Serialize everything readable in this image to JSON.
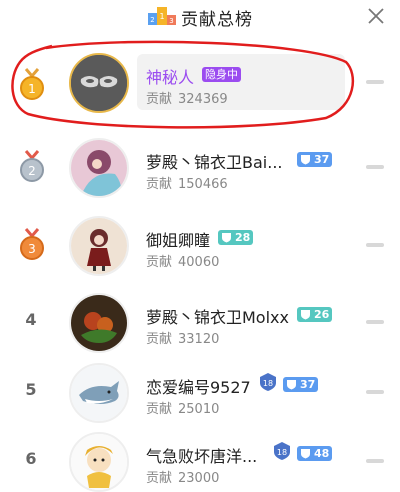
{
  "header": {
    "title": "贡献总榜"
  },
  "rows": [
    {
      "rank": "1",
      "name": "神秘人",
      "badge": "隐身中",
      "contrib_label": "贡献",
      "contrib_value": "324369"
    },
    {
      "rank": "2",
      "name": "萝殿丶锦衣卫Bai...",
      "level": "37",
      "contrib_label": "贡献",
      "contrib_value": "150466"
    },
    {
      "rank": "3",
      "name": "御姐卿瞳",
      "level": "28",
      "contrib_label": "贡献",
      "contrib_value": "40060"
    },
    {
      "rank": "4",
      "name": "萝殿丶锦衣卫Molxx",
      "level": "26",
      "contrib_label": "贡献",
      "contrib_value": "33120"
    },
    {
      "rank": "5",
      "name": "恋爱编号9527",
      "level": "37",
      "contrib_label": "贡献",
      "contrib_value": "25010"
    },
    {
      "rank": "6",
      "name": "气急败坏唐洋...",
      "level": "48",
      "contrib_label": "贡献",
      "contrib_value": "23000"
    }
  ]
}
